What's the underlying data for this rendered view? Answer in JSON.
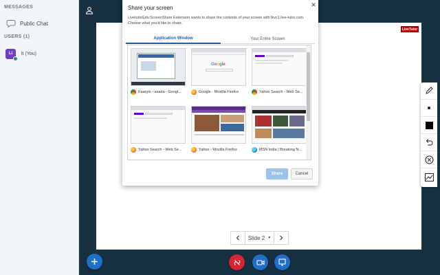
{
  "sidebar": {
    "messages_heading": "MESSAGES",
    "public_chat_label": "Public Chat",
    "users_heading": "USERS (1)",
    "user": {
      "avatar_initials": "Li",
      "name": "lt (You)"
    }
  },
  "presentation": {
    "logo_text": "LiveTutor",
    "slide_label": "Slide 2"
  },
  "share_dialog": {
    "title": "Share your screen",
    "description": "LivetutorEdu ScreenShare Extension wants to share the contents of your screen with lkvc1.live-tutor.com. Choose what you'd like to share.",
    "tabs": [
      {
        "label": "Application Window",
        "active": true
      },
      {
        "label": "Your Entire Screen",
        "active": false
      }
    ],
    "windows": [
      {
        "label": "Kaaryin - asada - Googl...",
        "icon": "chrome-icon"
      },
      {
        "label": "Google - Mozilla Firefox",
        "icon": "firefox-icon"
      },
      {
        "label": "Yahoo Search - Web Se...",
        "icon": "chrome-icon"
      },
      {
        "label": "Yahoo Search - Web Se...",
        "icon": "firefox-icon"
      },
      {
        "label": "Yahoo - Mozilla Firefox",
        "icon": "firefox-icon"
      },
      {
        "label": "MSN India | Breaking N...",
        "icon": "edge-icon"
      }
    ],
    "share_label": "Share",
    "cancel_label": "Cancel"
  },
  "toolbar_tools": [
    "pencil-icon",
    "dot-icon",
    "square-icon",
    "undo-icon",
    "clear-icon",
    "chart-icon"
  ],
  "colors": {
    "sidebar_bg": "#f3f6f9",
    "canvas_bg": "#16303f",
    "accent_blue": "#1a5db8",
    "hangup_red": "#d9232e",
    "action_blue": "#1e6fc8"
  }
}
